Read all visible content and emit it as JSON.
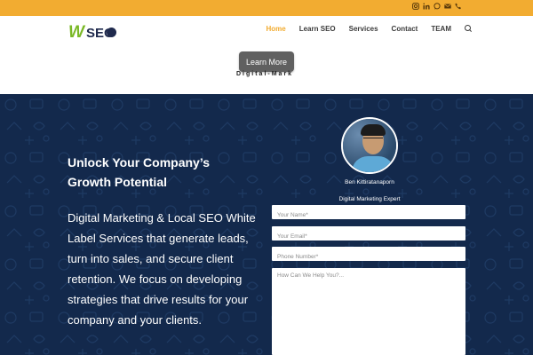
{
  "topbar": {
    "bg_color": "#f2ac31",
    "social_icons": [
      "instagram-icon",
      "linkedin-icon",
      "whatsapp-icon",
      "email-icon",
      "phone-icon"
    ]
  },
  "logo": {
    "letter": "W",
    "text": "SEO"
  },
  "nav": {
    "items": [
      {
        "label": "Home",
        "active": true
      },
      {
        "label": "Learn SEO",
        "active": false
      },
      {
        "label": "Services",
        "active": false
      },
      {
        "label": "Contact",
        "active": false
      },
      {
        "label": "TEAM",
        "active": false
      }
    ],
    "active_color": "#f2ac31"
  },
  "banner": {
    "button_label": "Learn More",
    "marquee_text": "Digital-Mark"
  },
  "hero": {
    "bg_color": "#13294c",
    "title": "Unlock Your Company’s Growth Potential",
    "text": "Digital Marketing & Local SEO White Label Services that generate leads, turn into sales, and secure client retention. We focus on developing strategies that drive results for your company and your clients."
  },
  "profile": {
    "name": "Ben Kittiratanaporn",
    "role": "Digital Marketing Expert"
  },
  "form": {
    "name_placeholder": "Your Name*",
    "email_placeholder": "Your Email*",
    "phone_placeholder": "Phone Number*",
    "message_placeholder": "How Can We Help You?..."
  }
}
